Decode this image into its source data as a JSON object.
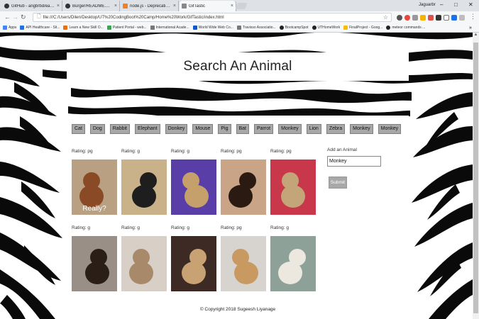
{
  "browser": {
    "tabs": [
      {
        "title": "GitHub - angbrbd/eat-d...",
        "active": false
      },
      {
        "title": "Burger/README.md at m...",
        "active": false
      },
      {
        "title": "node.js - DeprecationWa...",
        "active": false
      },
      {
        "title": "GifTastic",
        "active": true
      }
    ],
    "user_label": "Jaguarbr",
    "url": "file:///C:/Users/Dilen/Desktop/UT%20CodingBoot%20Camp/Home%20Work/GifTastic/index.html",
    "bookmarks": [
      {
        "label": "Apps",
        "color": "#4285f4"
      },
      {
        "label": "API Healthcare - Sit...",
        "color": "#1a73e8"
      },
      {
        "label": "Learn a New Skill O...",
        "color": "#e8710a"
      },
      {
        "label": "Patient Portal - web...",
        "color": "#34a853"
      },
      {
        "label": "International Acade...",
        "color": "#777777"
      },
      {
        "label": "World Wide Web Co...",
        "color": "#0b57d0"
      },
      {
        "label": "Travisso Associatio...",
        "color": "#777777"
      },
      {
        "label": "BootcampSpot",
        "color": "#222222"
      },
      {
        "label": "UTHomeWork",
        "color": "#222222"
      },
      {
        "label": "FinalProject - Goog...",
        "color": "#fbbc04"
      },
      {
        "label": "meteor commands ...",
        "color": "#222222"
      }
    ],
    "more": "»"
  },
  "page": {
    "title": "Search An Animal",
    "buttons": [
      "Cat",
      "Dog",
      "Rabbit",
      "Elephant",
      "Donkey",
      "Mouse",
      "Pig",
      "Bat",
      "Parrot",
      "Monkey",
      "Lion",
      "Zebra",
      "Monkey",
      "Monkey"
    ],
    "gifs": [
      {
        "rating": "Rating: pg",
        "bg": "#b9a083",
        "fg": "#8a4a26",
        "caption": "Really?"
      },
      {
        "rating": "Rating: g",
        "bg": "#c9b28a",
        "fg": "#1e1e1e",
        "caption": ""
      },
      {
        "rating": "Rating: g",
        "bg": "#5a3ea8",
        "fg": "#c6a06a",
        "caption": ""
      },
      {
        "rating": "Rating: pg",
        "bg": "#c9a486",
        "fg": "#2a1a12",
        "caption": ""
      },
      {
        "rating": "Rating: pg",
        "bg": "#c9384a",
        "fg": "#c4a57a",
        "caption": ""
      },
      {
        "rating": "Rating: g",
        "bg": "#9a8f86",
        "fg": "#2a1e16",
        "caption": ""
      },
      {
        "rating": "Rating: g",
        "bg": "#d8cfc7",
        "fg": "#a88a6a",
        "caption": ""
      },
      {
        "rating": "Rating: g",
        "bg": "#3d2a24",
        "fg": "#c8a272",
        "caption": ""
      },
      {
        "rating": "Rating: pg",
        "bg": "#d7d4cf",
        "fg": "#c89a62",
        "caption": ""
      },
      {
        "rating": "Rating: g",
        "bg": "#8ea199",
        "fg": "#ece8e0",
        "caption": ""
      }
    ],
    "form": {
      "label": "Add an Animal",
      "value": "Monkey",
      "submit": "Submit"
    },
    "footer": "© Copyright 2018 Sugeesh Liyanage"
  }
}
